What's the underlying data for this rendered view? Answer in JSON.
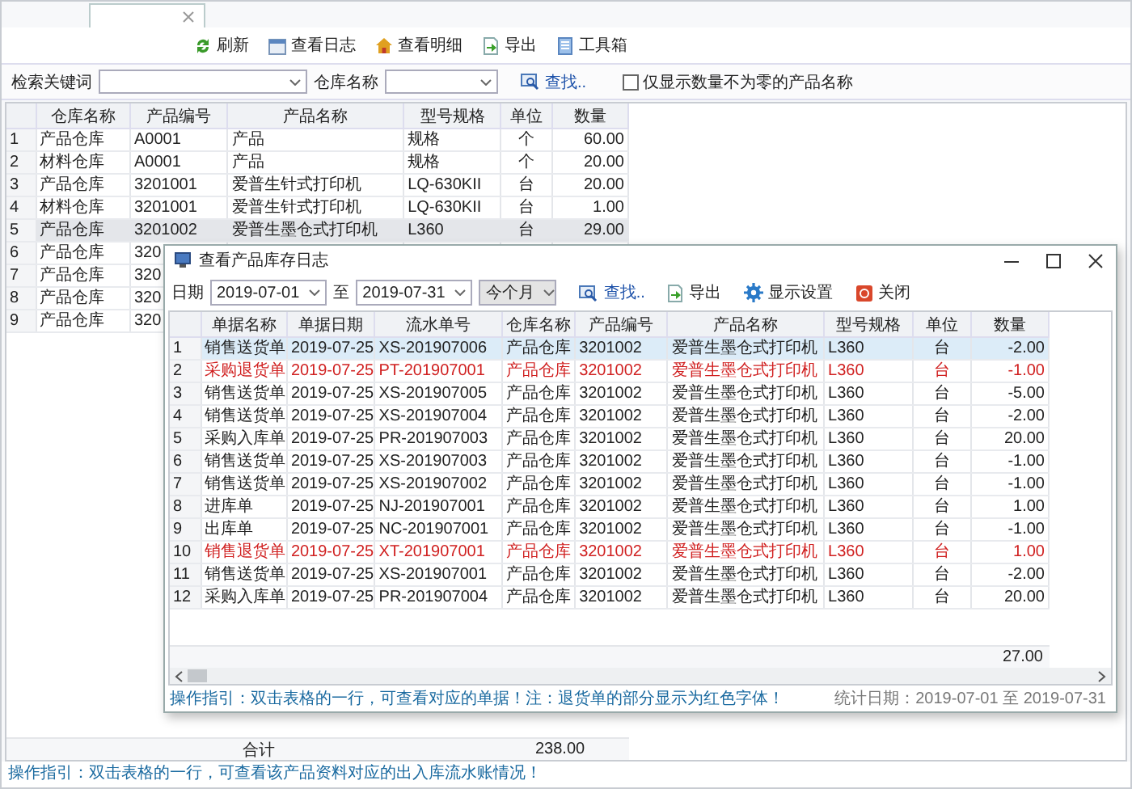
{
  "toolbar": [
    {
      "label": "刷新"
    },
    {
      "label": "查看日志"
    },
    {
      "label": "查看明细"
    },
    {
      "label": "导出"
    },
    {
      "label": "工具箱"
    }
  ],
  "filter": {
    "keyword_label": "检索关键词",
    "warehouse_label": "仓库名称",
    "search": "查找..",
    "nonzero_only": {
      "label": "仅显示数量不为零的产品名称",
      "checked": false
    }
  },
  "table": {
    "columns": [
      "仓库名称",
      "产品编号",
      "产品名称",
      "型号规格",
      "单位",
      "数量"
    ],
    "rows": [
      {
        "no": "1",
        "cells": [
          "产品仓库",
          "A0001",
          "产品",
          "规格",
          "个",
          "60.00"
        ],
        "selected": false
      },
      {
        "no": "2",
        "cells": [
          "材料仓库",
          "A0001",
          "产品",
          "规格",
          "个",
          "20.00"
        ],
        "selected": false
      },
      {
        "no": "3",
        "cells": [
          "产品仓库",
          "3201001",
          "爱普生针式打印机",
          "LQ-630KII",
          "台",
          "20.00"
        ],
        "selected": false
      },
      {
        "no": "4",
        "cells": [
          "材料仓库",
          "3201001",
          "爱普生针式打印机",
          "LQ-630KII",
          "台",
          "1.00"
        ],
        "selected": false
      },
      {
        "no": "5",
        "cells": [
          "产品仓库",
          "3201002",
          "爱普生墨仓式打印机",
          "L360",
          "台",
          "29.00"
        ],
        "selected": true
      },
      {
        "no": "6",
        "cells": [
          "产品仓库",
          "320"
        ],
        "selected": false
      },
      {
        "no": "7",
        "cells": [
          "产品仓库",
          "320"
        ],
        "selected": false
      },
      {
        "no": "8",
        "cells": [
          "产品仓库",
          "320"
        ],
        "selected": false
      },
      {
        "no": "9",
        "cells": [
          "产品仓库",
          "320"
        ],
        "selected": false
      }
    ],
    "total_label": "合计",
    "total": "238.00"
  },
  "status_bar": "操作指引：双击表格的一行，可查看该产品资料对应的出入库流水账情况！",
  "dialog": {
    "title": "查看产品库存日志",
    "date_label": "日期",
    "from": "2019-07-01",
    "to_label": "至",
    "to": "2019-07-31",
    "period": "今个月",
    "actions": [
      {
        "label": "查找.."
      },
      {
        "label": "导出"
      },
      {
        "label": "显示设置"
      },
      {
        "label": "关闭"
      }
    ],
    "columns": [
      "单据名称",
      "单据日期",
      "流水单号",
      "仓库名称",
      "产品编号",
      "产品名称",
      "型号规格",
      "单位",
      "数量"
    ],
    "rows": [
      {
        "no": "1",
        "cells": [
          "销售送货单",
          "2019-07-25",
          "XS-201907006",
          "产品仓库",
          "3201002",
          "爱普生墨仓式打印机",
          "L360",
          "台",
          "-2.00"
        ],
        "returned": false,
        "selected": true
      },
      {
        "no": "2",
        "cells": [
          "采购退货单",
          "2019-07-25",
          "PT-201907001",
          "产品仓库",
          "3201002",
          "爱普生墨仓式打印机",
          "L360",
          "台",
          "-1.00"
        ],
        "returned": true,
        "selected": false
      },
      {
        "no": "3",
        "cells": [
          "销售送货单",
          "2019-07-25",
          "XS-201907005",
          "产品仓库",
          "3201002",
          "爱普生墨仓式打印机",
          "L360",
          "台",
          "-5.00"
        ],
        "returned": false,
        "selected": false
      },
      {
        "no": "4",
        "cells": [
          "销售送货单",
          "2019-07-25",
          "XS-201907004",
          "产品仓库",
          "3201002",
          "爱普生墨仓式打印机",
          "L360",
          "台",
          "-2.00"
        ],
        "returned": false,
        "selected": false
      },
      {
        "no": "5",
        "cells": [
          "采购入库单",
          "2019-07-25",
          "PR-201907003",
          "产品仓库",
          "3201002",
          "爱普生墨仓式打印机",
          "L360",
          "台",
          "20.00"
        ],
        "returned": false,
        "selected": false
      },
      {
        "no": "6",
        "cells": [
          "销售送货单",
          "2019-07-25",
          "XS-201907003",
          "产品仓库",
          "3201002",
          "爱普生墨仓式打印机",
          "L360",
          "台",
          "-1.00"
        ],
        "returned": false,
        "selected": false
      },
      {
        "no": "7",
        "cells": [
          "销售送货单",
          "2019-07-25",
          "XS-201907002",
          "产品仓库",
          "3201002",
          "爱普生墨仓式打印机",
          "L360",
          "台",
          "-1.00"
        ],
        "returned": false,
        "selected": false
      },
      {
        "no": "8",
        "cells": [
          "进库单",
          "2019-07-25",
          "NJ-201907001",
          "产品仓库",
          "3201002",
          "爱普生墨仓式打印机",
          "L360",
          "台",
          "1.00"
        ],
        "returned": false,
        "selected": false
      },
      {
        "no": "9",
        "cells": [
          "出库单",
          "2019-07-25",
          "NC-201907001",
          "产品仓库",
          "3201002",
          "爱普生墨仓式打印机",
          "L360",
          "台",
          "-1.00"
        ],
        "returned": false,
        "selected": false
      },
      {
        "no": "10",
        "cells": [
          "销售退货单",
          "2019-07-25",
          "XT-201907001",
          "产品仓库",
          "3201002",
          "爱普生墨仓式打印机",
          "L360",
          "台",
          "1.00"
        ],
        "returned": true,
        "selected": false
      },
      {
        "no": "11",
        "cells": [
          "销售送货单",
          "2019-07-25",
          "XS-201907001",
          "产品仓库",
          "3201002",
          "爱普生墨仓式打印机",
          "L360",
          "台",
          "-2.00"
        ],
        "returned": false,
        "selected": false
      },
      {
        "no": "12",
        "cells": [
          "采购入库单",
          "2019-07-25",
          "PR-201907004",
          "产品仓库",
          "3201002",
          "爱普生墨仓式打印机",
          "L360",
          "台",
          "20.00"
        ],
        "returned": false,
        "selected": false
      }
    ],
    "total": "27.00",
    "guide": "操作指引：双击表格的一行，可查看对应的单据！注：退货单的部分显示为红色字体！",
    "stats": "统计日期：2019-07-01 至 2019-07-31"
  }
}
